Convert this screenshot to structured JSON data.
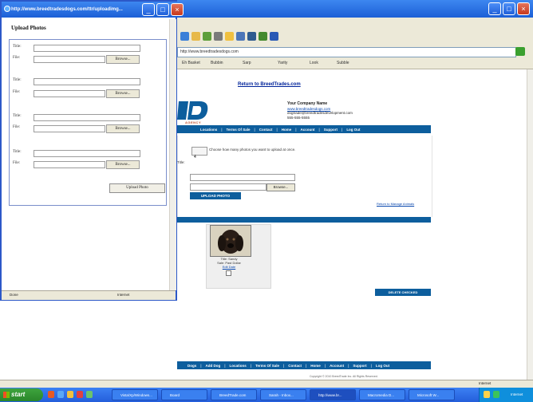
{
  "main_window": {
    "address": "http://www.breedtradesdogs.com",
    "links": [
      "Eh Basket",
      "Bubbin",
      "Sarp",
      "Yarity",
      "Look",
      "Subble"
    ],
    "return_link": "Return to BreedTrades.com",
    "logo_tag": "AGENCY",
    "company": {
      "name": "Your Company Name",
      "website": "www.breedtradesdogs.com",
      "email": "dogtrade@breedtradesdevelopment.com",
      "phone": "555-555-5555"
    },
    "nav_top": [
      "Locations",
      "Terms Of Sale",
      "Contact",
      "Home",
      "Account",
      "Support",
      "Log Out"
    ],
    "count_value": "4",
    "count_text": "Choose how many photos you want to upload at once.",
    "panel_label": "Title:",
    "browse_label": "Browse...",
    "upload_button": "UPLOAD PHOTO",
    "return_manage": "Return to Manage Animals",
    "photo": {
      "caption_lines": [
        "Title: Sandy",
        "Sale: Past Dollar"
      ],
      "edit_link": "Edit Date"
    },
    "delete_button": "DELETE CHECKED",
    "nav_bottom": [
      "Dogs",
      "Add Dog",
      "Locations",
      "Terms Of Sale",
      "Contact",
      "Home",
      "Account",
      "Support",
      "Log Out"
    ],
    "copyright": "Copyright © 2010 BreedTrade Inc. All Rights Reserved.",
    "status_zone": "Internet"
  },
  "popup": {
    "title": "http://www.breedtradesdogs.com/ttr/uploadimg...",
    "heading": "Upload Photos",
    "title_label": "Title:",
    "file_label": "File:",
    "browse_label": "Browse...",
    "upload_button": "Upload Photo",
    "status_left": "Done",
    "status_right": "Internet"
  },
  "taskbar": {
    "start": "start",
    "tasks": [
      "Vista/Xp/Windows...",
      "Board",
      "BreedTrade.com",
      "Sarah - Inbox...",
      "http://www.br...",
      "Macromedia D...",
      "Microsoft W..."
    ],
    "clock": "Internet"
  },
  "colors": {
    "xp_blue": "#245edb",
    "site_nav": "#0d5e9d",
    "start_green": "#2a862a"
  }
}
